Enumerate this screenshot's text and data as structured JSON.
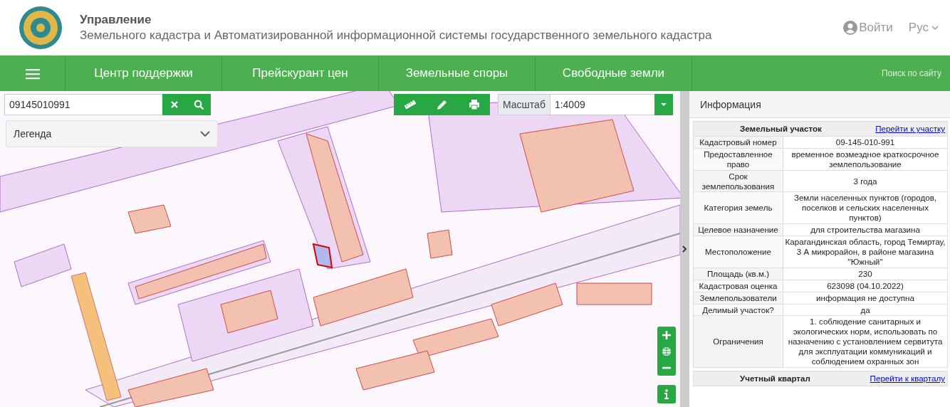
{
  "header": {
    "title": "Управление",
    "subtitle": "Земельного кадастра и Автоматизированной информационной системы государственного земельного кадастра",
    "login": "Войти",
    "language": "Рус"
  },
  "nav": {
    "items": [
      "Центр поддержки",
      "Прейскурант цен",
      "Земельные споры",
      "Свободные земли"
    ],
    "search_placeholder": "Поиск по сайту"
  },
  "map": {
    "search_value": "09145010991",
    "legend": "Легенда",
    "scale_label": "Масштаб",
    "scale_value": "1:4009"
  },
  "info": {
    "title": "Информация",
    "sections": [
      {
        "heading": "Земельный участок",
        "link": "Перейти к участку",
        "rows": [
          {
            "label": "Кадастровый номер",
            "value": "09-145-010-991"
          },
          {
            "label": "Предоставленное право",
            "value": "временное возмездное краткосрочное землепользование"
          },
          {
            "label": "Срок землепользования",
            "value": "3 года"
          },
          {
            "label": "Категория земель",
            "value": "Земли населенных пунктов (городов, поселков и сельских населенных пунктов)"
          },
          {
            "label": "Целевое назначение",
            "value": "для строительства магазина"
          },
          {
            "label": "Местоположение",
            "value": "Карагандинская область, город Темиртау, 3 А микрорайон, в районе магазина \"Южный\""
          },
          {
            "label": "Площадь (кв.м.)",
            "value": "230"
          },
          {
            "label": "Кадастровая оценка",
            "value": "623098 (04.10.2022)"
          },
          {
            "label": "Землепользователи",
            "value": "информация не доступна"
          },
          {
            "label": "Делимый участок?",
            "value": "да"
          },
          {
            "label": "Ограничения",
            "value": "1. соблюдение санитарных и экологических норм, использовать по назначению с установлением сервитута для эксплуатации коммуникаций и соблюдением охранных зон"
          }
        ]
      },
      {
        "heading": "Учетный квартал",
        "link": "Перейти к кварталу"
      }
    ]
  }
}
